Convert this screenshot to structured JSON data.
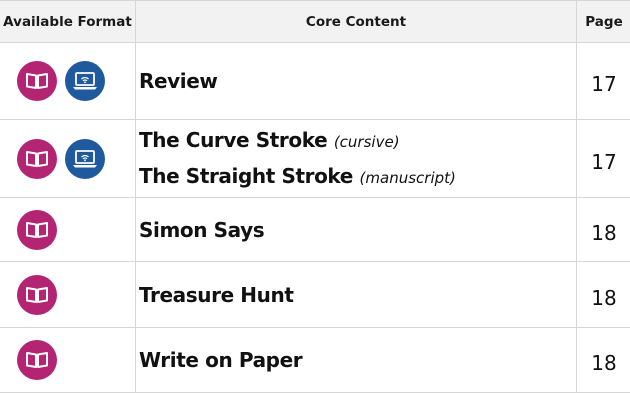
{
  "colors": {
    "book_icon": "#b32472",
    "laptop_icon": "#1f5a9e",
    "header_bg": "#f2f2f2",
    "grid": "#d6d6d6"
  },
  "table": {
    "headers": {
      "format": "Available Format",
      "content": "Core Content",
      "page": "Page"
    },
    "rows": [
      {
        "formats": [
          "open-book-icon",
          "laptop-wifi-icon"
        ],
        "lines": [
          {
            "text": "Review",
            "note": ""
          }
        ],
        "page": "17"
      },
      {
        "formats": [
          "open-book-icon",
          "laptop-wifi-icon"
        ],
        "lines": [
          {
            "text": "The Curve Stroke",
            "note": "(cursive)"
          },
          {
            "text": "The Straight Stroke",
            "note": "(manuscript)"
          }
        ],
        "page": "17"
      },
      {
        "formats": [
          "open-book-icon"
        ],
        "lines": [
          {
            "text": "Simon Says",
            "note": ""
          }
        ],
        "page": "18"
      },
      {
        "formats": [
          "open-book-icon"
        ],
        "lines": [
          {
            "text": "Treasure Hunt",
            "note": ""
          }
        ],
        "page": "18"
      },
      {
        "formats": [
          "open-book-icon"
        ],
        "lines": [
          {
            "text": "Write on Paper",
            "note": ""
          }
        ],
        "page": "18"
      }
    ]
  }
}
